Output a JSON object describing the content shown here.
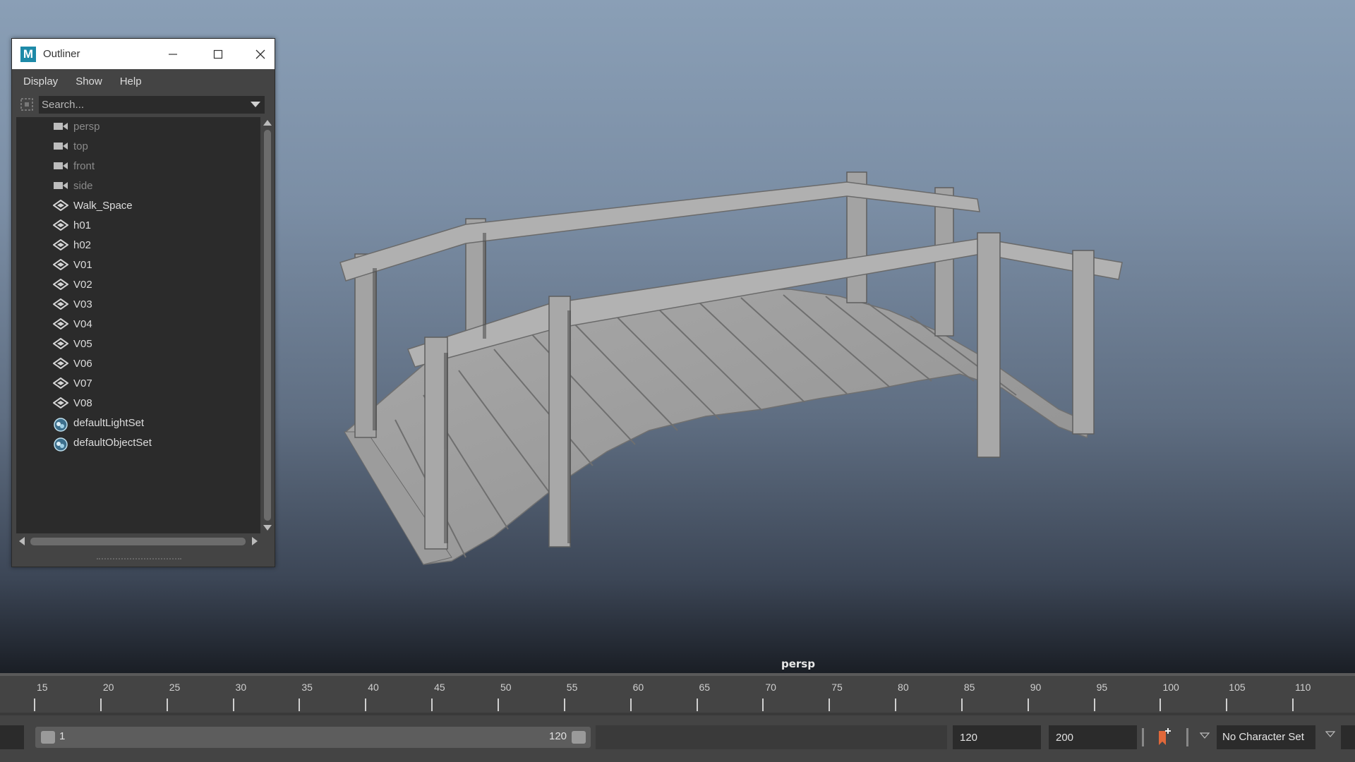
{
  "viewport": {
    "camera_label": "persp"
  },
  "outliner": {
    "title": "Outliner",
    "menu": [
      "Display",
      "Show",
      "Help"
    ],
    "search_placeholder": "Search...",
    "items": [
      {
        "label": "persp",
        "icon": "camera-icon",
        "dim": true
      },
      {
        "label": "top",
        "icon": "camera-icon",
        "dim": true
      },
      {
        "label": "front",
        "icon": "camera-icon",
        "dim": true
      },
      {
        "label": "side",
        "icon": "camera-icon",
        "dim": true
      },
      {
        "label": "Walk_Space",
        "icon": "transform-icon",
        "dim": false
      },
      {
        "label": "h01",
        "icon": "transform-icon",
        "dim": false
      },
      {
        "label": "h02",
        "icon": "transform-icon",
        "dim": false
      },
      {
        "label": "V01",
        "icon": "transform-icon",
        "dim": false
      },
      {
        "label": "V02",
        "icon": "transform-icon",
        "dim": false
      },
      {
        "label": "V03",
        "icon": "transform-icon",
        "dim": false
      },
      {
        "label": "V04",
        "icon": "transform-icon",
        "dim": false
      },
      {
        "label": "V05",
        "icon": "transform-icon",
        "dim": false
      },
      {
        "label": "V06",
        "icon": "transform-icon",
        "dim": false
      },
      {
        "label": "V07",
        "icon": "transform-icon",
        "dim": false
      },
      {
        "label": "V08",
        "icon": "transform-icon",
        "dim": false
      },
      {
        "label": "defaultLightSet",
        "icon": "set-icon",
        "dim": false
      },
      {
        "label": "defaultObjectSet",
        "icon": "set-icon",
        "dim": false
      }
    ]
  },
  "timeline": {
    "ticks": [
      "15",
      "20",
      "25",
      "30",
      "35",
      "40",
      "45",
      "50",
      "55",
      "60",
      "65",
      "70",
      "75",
      "80",
      "85",
      "90",
      "95",
      "100",
      "105",
      "110"
    ]
  },
  "range": {
    "start": "1",
    "end": "120",
    "anim_end": "120",
    "max_end": "200",
    "character_set": "No Character Set"
  },
  "colors": {
    "accent_key": "#e0683a",
    "maya_logo": "#1e8aa8"
  }
}
